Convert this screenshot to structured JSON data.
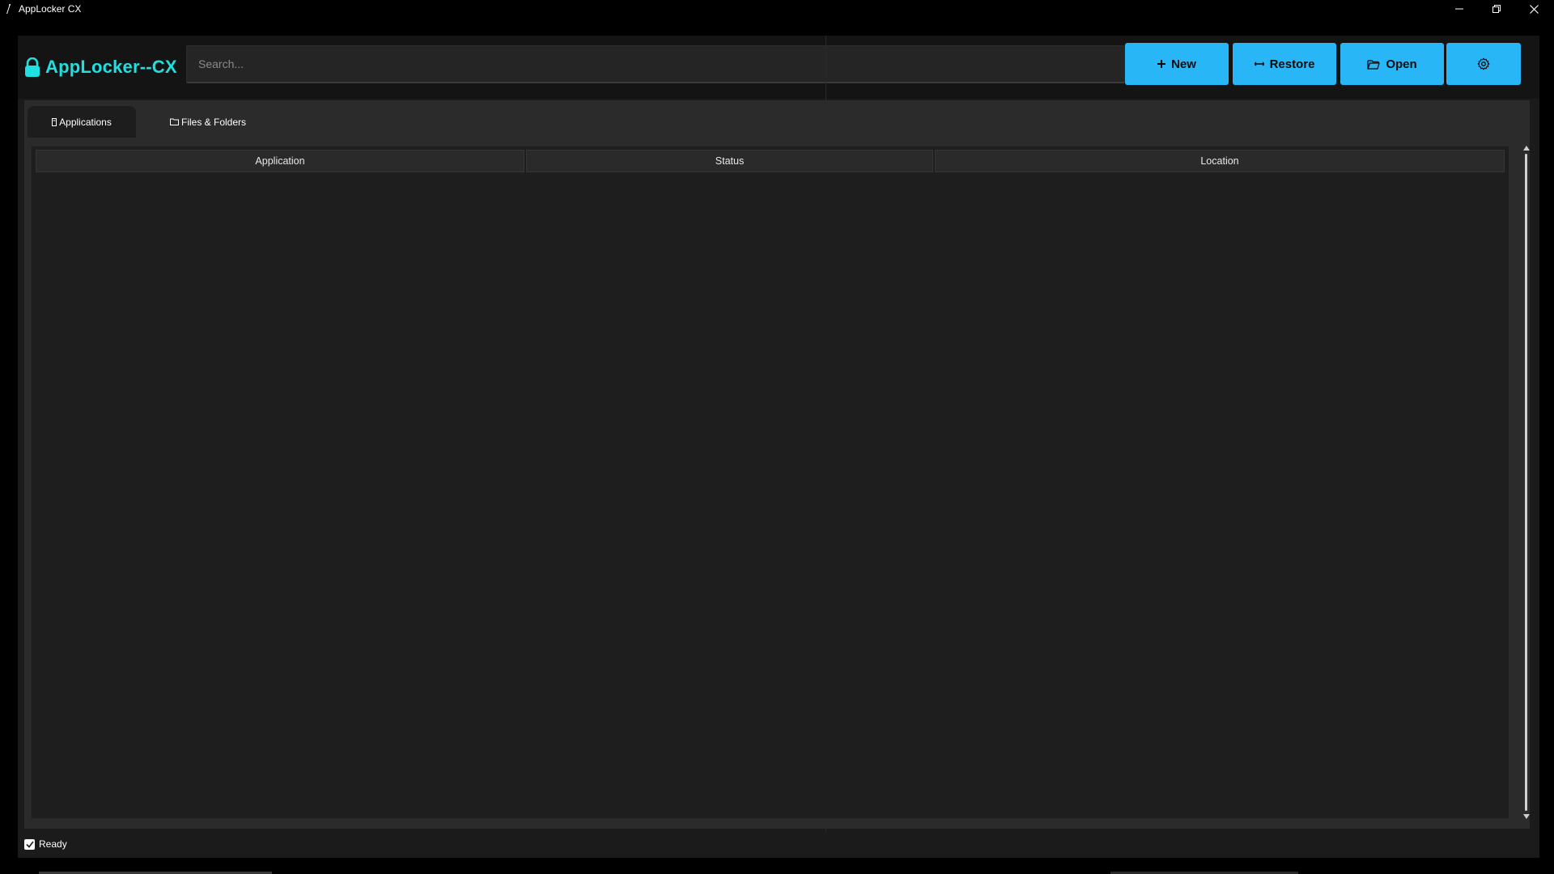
{
  "window": {
    "title": "AppLocker CX",
    "controls": {
      "minimize": "minimize-icon",
      "restore": "restore-icon",
      "close": "close-icon"
    }
  },
  "header": {
    "logo_icon": "lock-icon",
    "logo_text": "AppLocker--CX",
    "search": {
      "placeholder": "Search...",
      "value": ""
    },
    "buttons": [
      {
        "label": "New",
        "icon": "plus-icon"
      },
      {
        "label": "Restore",
        "icon": "arrows-icon"
      },
      {
        "label": "Open",
        "icon": "folder-open-icon"
      },
      {
        "label": "",
        "icon": "gear-icon"
      }
    ]
  },
  "tabs": [
    {
      "label": "Applications",
      "icon": "app-icon",
      "active": true
    },
    {
      "label": "Files & Folders",
      "icon": "folder-icon",
      "active": false
    }
  ],
  "table": {
    "columns": [
      "Application",
      "Status",
      "Location"
    ],
    "rows": []
  },
  "status": {
    "text": "Ready",
    "checked": true
  },
  "colors": {
    "accent": "#1ee0e0",
    "button_bg": "#29b6f6",
    "window_bg": "#1b1b1b",
    "panel_bg": "#2b2b2b"
  }
}
